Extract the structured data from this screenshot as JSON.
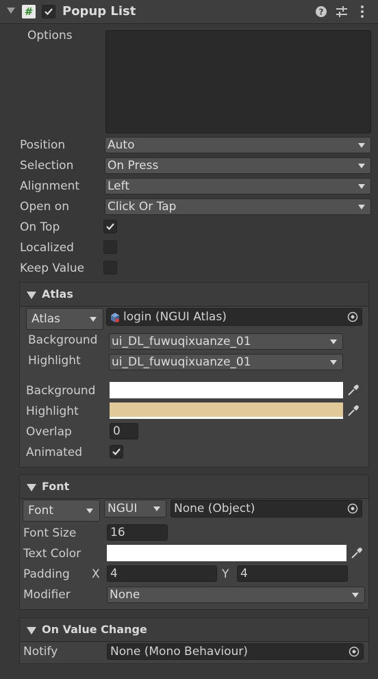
{
  "header": {
    "title": "Popup List",
    "hash_symbol": "#",
    "enabled": true,
    "icons": [
      "fold-triangle-icon",
      "script-icon",
      "help-icon",
      "preset-icon",
      "kebab-menu-icon"
    ]
  },
  "options": {
    "label": "Options",
    "value": ""
  },
  "position": {
    "label": "Position",
    "value": "Auto"
  },
  "selection": {
    "label": "Selection",
    "value": "On Press"
  },
  "alignment": {
    "label": "Alignment",
    "value": "Left"
  },
  "open_on": {
    "label": "Open on",
    "value": "Click Or Tap"
  },
  "on_top": {
    "label": "On Top",
    "checked": true
  },
  "localized": {
    "label": "Localized",
    "checked": false
  },
  "keep_value": {
    "label": "Keep Value",
    "checked": false
  },
  "atlas_section": {
    "title": "Atlas",
    "type_dropdown": "Atlas",
    "atlas_value": "login (NGUI Atlas)",
    "sprite_background_label": "Background",
    "sprite_background_value": "ui_DL_fuwuqixuanze_01",
    "sprite_highlight_label": "Highlight",
    "sprite_highlight_value": "ui_DL_fuwuqixuanze_01",
    "color_background_label": "Background",
    "color_background": "#ffffff",
    "color_highlight_label": "Highlight",
    "color_highlight": "#e2c999",
    "overlap_label": "Overlap",
    "overlap_value": "0",
    "animated_label": "Animated",
    "animated": true
  },
  "font_section": {
    "title": "Font",
    "type_dropdown": "Font",
    "font_kind": "NGUI",
    "font_value": "None (Object)",
    "font_size_label": "Font Size",
    "font_size_value": "16",
    "text_color_label": "Text Color",
    "text_color": "#ffffff",
    "padding_label": "Padding",
    "padding_x_label": "X",
    "padding_x": "4",
    "padding_y_label": "Y",
    "padding_y": "4",
    "modifier_label": "Modifier",
    "modifier_value": "None"
  },
  "value_change_section": {
    "title": "On Value Change",
    "notify_label": "Notify",
    "notify_value": "None (Mono Behaviour)"
  },
  "colors": {
    "panel_bg": "#383838",
    "field_bg": "#2a2a2a",
    "dropdown_bg": "#515151",
    "text": "#cfcfcf"
  }
}
